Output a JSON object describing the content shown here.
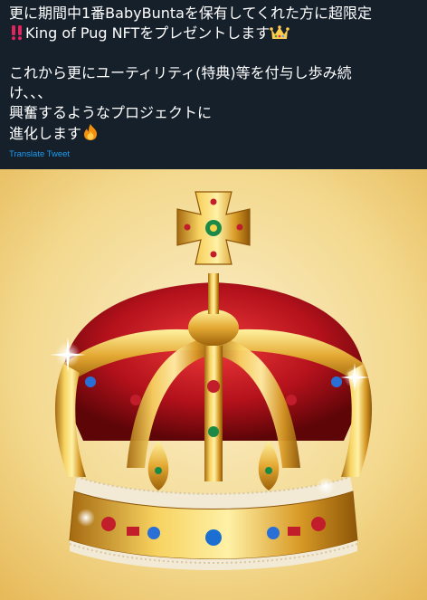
{
  "tweet": {
    "lines": [
      "更に期間中1番BabyBuntaを保有してくれた方に超限定",
      "King of Pug NFTをプレゼントします",
      "",
      "これから更にユーティリティ(特典)等を付与し歩み続",
      "け、、、",
      "興奮するようなプロジェクトに",
      "進化します"
    ],
    "emojis": {
      "line2_prefix": "double-exclamation-icon",
      "line2_suffix": "crown-icon",
      "line7_suffix": "fire-icon"
    }
  },
  "translate_link": "Translate Tweet",
  "media": {
    "subject": "crown-image",
    "colors": {
      "gold": "#e8b433",
      "red": "#b3111b",
      "background": "#f2d894"
    }
  }
}
